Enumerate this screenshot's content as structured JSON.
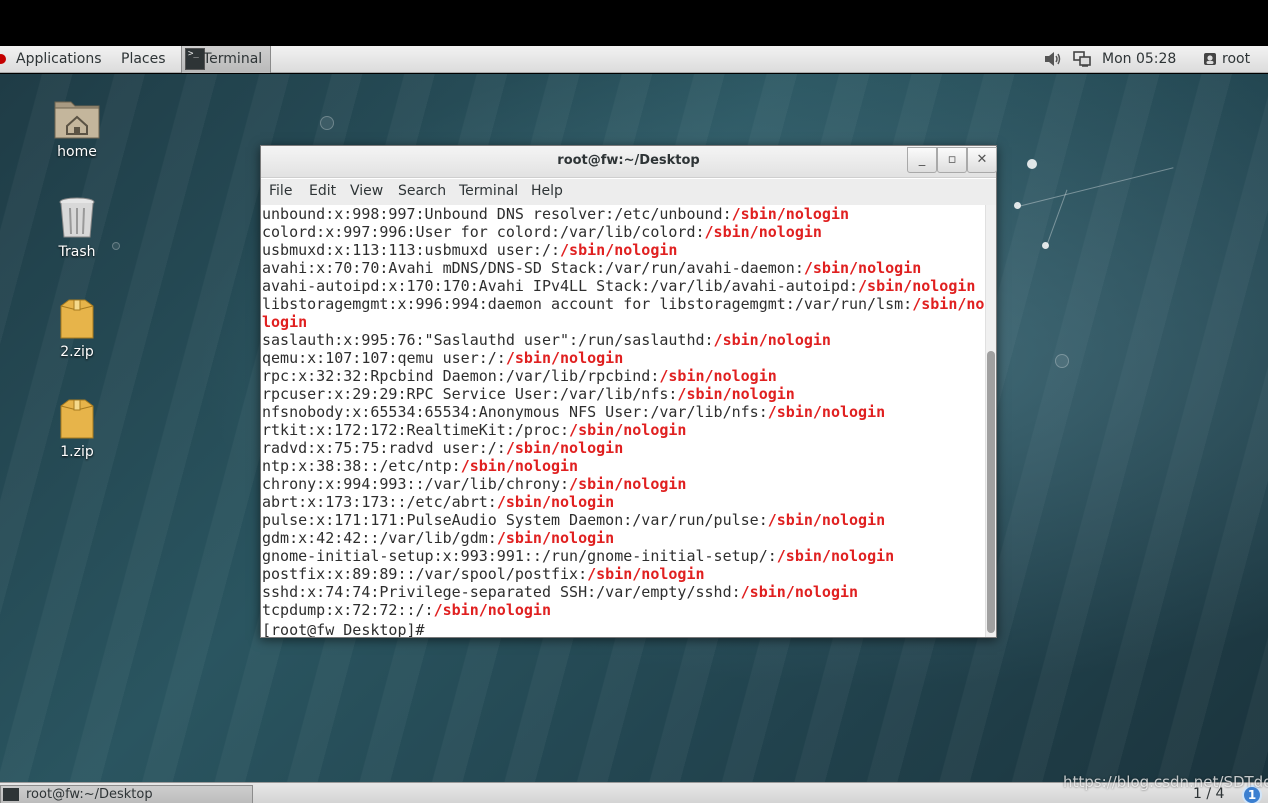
{
  "top_panel": {
    "applications": "Applications",
    "places": "Places",
    "task_label": "Terminal",
    "clock": "Mon 05:28",
    "user": "root",
    "icons": [
      "fedora-logo-icon",
      "terminal-icon",
      "volume-icon",
      "network-icon",
      "user-icon"
    ]
  },
  "desktop": {
    "icons": [
      {
        "label": "home",
        "icon": "home-folder-icon"
      },
      {
        "label": "Trash",
        "icon": "trash-icon"
      },
      {
        "label": "2.zip",
        "icon": "archive-icon"
      },
      {
        "label": "1.zip",
        "icon": "archive-icon"
      }
    ]
  },
  "window": {
    "title": "root@fw:~/Desktop",
    "buttons": [
      "minimize",
      "maximize",
      "close"
    ],
    "menu": [
      "File",
      "Edit",
      "View",
      "Search",
      "Terminal",
      "Help"
    ]
  },
  "terminal": {
    "lines": [
      [
        "unbound:x:998:997:Unbound DNS resolver:/etc/unbound:",
        "/sbin/nologin"
      ],
      [
        "colord:x:997:996:User for colord:/var/lib/colord:",
        "/sbin/nologin"
      ],
      [
        "usbmuxd:x:113:113:usbmuxd user:/:",
        "/sbin/nologin"
      ],
      [
        "avahi:x:70:70:Avahi mDNS/DNS-SD Stack:/var/run/avahi-daemon:",
        "/sbin/nologin"
      ],
      [
        "avahi-autoipd:x:170:170:Avahi IPv4LL Stack:/var/lib/avahi-autoipd:",
        "/sbin/nologin"
      ],
      [
        "libstoragemgmt:x:996:994:daemon account for libstoragemgmt:/var/run/lsm:",
        "/sbin/no"
      ],
      [
        "",
        "login"
      ],
      [
        "saslauth:x:995:76:\"Saslauthd user\":/run/saslauthd:",
        "/sbin/nologin"
      ],
      [
        "qemu:x:107:107:qemu user:/:",
        "/sbin/nologin"
      ],
      [
        "rpc:x:32:32:Rpcbind Daemon:/var/lib/rpcbind:",
        "/sbin/nologin"
      ],
      [
        "rpcuser:x:29:29:RPC Service User:/var/lib/nfs:",
        "/sbin/nologin"
      ],
      [
        "nfsnobody:x:65534:65534:Anonymous NFS User:/var/lib/nfs:",
        "/sbin/nologin"
      ],
      [
        "rtkit:x:172:172:RealtimeKit:/proc:",
        "/sbin/nologin"
      ],
      [
        "radvd:x:75:75:radvd user:/:",
        "/sbin/nologin"
      ],
      [
        "ntp:x:38:38::/etc/ntp:",
        "/sbin/nologin"
      ],
      [
        "chrony:x:994:993::/var/lib/chrony:",
        "/sbin/nologin"
      ],
      [
        "abrt:x:173:173::/etc/abrt:",
        "/sbin/nologin"
      ],
      [
        "pulse:x:171:171:PulseAudio System Daemon:/var/run/pulse:",
        "/sbin/nologin"
      ],
      [
        "gdm:x:42:42::/var/lib/gdm:",
        "/sbin/nologin"
      ],
      [
        "gnome-initial-setup:x:993:991::/run/gnome-initial-setup/:",
        "/sbin/nologin"
      ],
      [
        "postfix:x:89:89::/var/spool/postfix:",
        "/sbin/nologin"
      ],
      [
        "sshd:x:74:74:Privilege-separated SSH:/var/empty/sshd:",
        "/sbin/nologin"
      ],
      [
        "tcpdump:x:72:72::/:",
        "/sbin/nologin"
      ]
    ],
    "prompt": "[root@fw Desktop]# ",
    "highlight_color": "#e02020"
  },
  "bottom_panel": {
    "task_label": "root@fw:~/Desktop",
    "watermark": "https://blog.csdn.net/SDTdd",
    "workspace": "1 / 4",
    "notification_count": "1"
  }
}
